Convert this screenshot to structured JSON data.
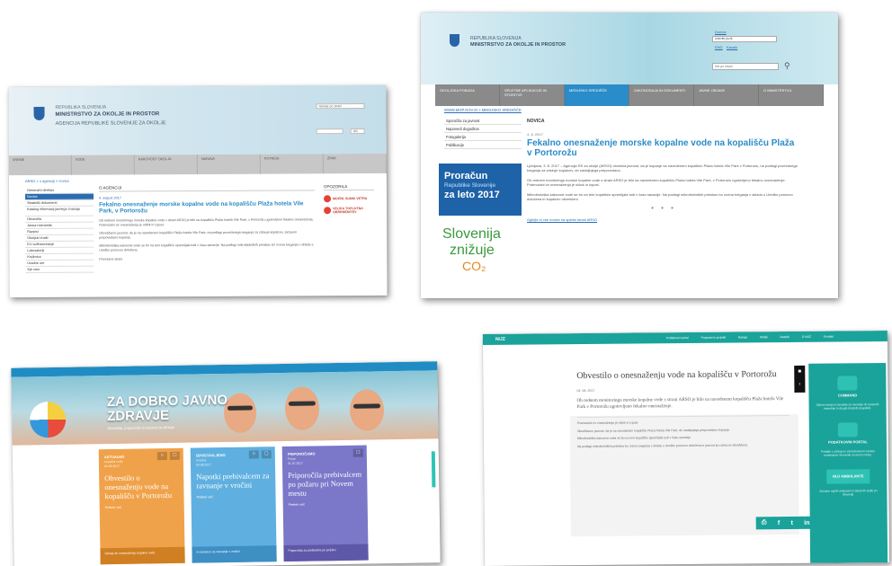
{
  "shot1": {
    "header": {
      "line1": "REPUBLIKA SLOVENIJA",
      "line2": "MINISTRSTVO ZA OKOLJE IN PROSTOR",
      "line3": "AGENCIJA REPUBLIKE SLOVENIJE ZA OKOLJE",
      "search_placeholder": "Iskanje po strani",
      "button_label": "Išči"
    },
    "nav": [
      "VREME",
      "VODE",
      "KAKOVOST OKOLJA",
      "NARAVA",
      "POTRESI",
      "ZRAK"
    ],
    "breadcrumb": "ARSO > o agenciji > novice",
    "left_nav": [
      "Generalni direktor",
      "Novice",
      "Strateški dokumenti",
      "Katalog informacij javnega značaja",
      "Obvestila",
      "Javna naznanila",
      "Razpisi",
      "Okoljski znaki",
      "EU sofinanciranje",
      "Laboratoriji",
      "Knjižnica",
      "Uradne ure",
      "Kje smo"
    ],
    "section": "O AGENCIJI",
    "date": "4. avgust 2017",
    "headline": "Fekalno onesnaženje morske kopalne vode na kopališču Plaža hotela Vile Park, v Portorožu",
    "paragraphs": [
      "Ob rednem monitoringu morske kopalne vode v strani ARSO je bilo na kopališču Plaža hotela Vile Park, v Portorožu ugotovljeno fekalno onesnaženje. Potencialni vir onesnaženja je odtok in izpust.",
      "Obveščamo javnost, da je na navedenem kopališču Plaža hotela Vile Park, na podlagi povečanega tveganja za zdravje kopalcev, začasno prepovedano kopanje.",
      "Mikrobiološka kakovost vode se bo na tem kopališču spremljala tudi v času sanacije. Na podlagi mikrobioloških preiskav bo ocena tveganja v skladu s Uredbo ponovno določena."
    ],
    "footer_label": "Povezane strani",
    "right_title": "OPOZORILA",
    "warnings": [
      "MOČNI, SUNKI VETRA",
      "VELIKA TOPLOTNA OBREMENITEV"
    ]
  },
  "shot2": {
    "header": {
      "line1": "REPUBLIKA SLOVENIJA",
      "line2": "MINISTRSTVO ZA OKOLJE IN PROSTOR",
      "link_top": "Domov",
      "select_value": "Izberite jezik",
      "link_en": "ENG",
      "link_sitemap": "Kazalo",
      "search_placeholder": "Išči po strani",
      "search_icon": "magnifier-icon"
    },
    "nav": [
      "OKOLJSKA POBUDA",
      "SPLETNE APLIKACIJE IN STORITVE",
      "MEDIJSKO SREDIŠČE",
      "ZAKONODAJA IN DOKUMENTI",
      "JAVNE OBJAVE",
      "O MINISTRSTVU"
    ],
    "breadcrumb": "WWW.MOP.GOV.SI > MEDIJSKO SREDIŠČE",
    "left_nav": [
      "Sporočila za javnost",
      "Napovedi dogodkov",
      "Fotogalerija",
      "Publikacije"
    ],
    "banner1": {
      "line1": "Proračun",
      "line2": "Republike Slovenije",
      "line3": "za leto 2017"
    },
    "banner2": {
      "line1": "Slovenija",
      "line2": "znižuje",
      "line3": "CO₂"
    },
    "section": "NOVICA",
    "date": "4. 8. 2017",
    "headline": "Fekalno onesnaženje morske kopalne vode na kopališču Plaža v Portorožu",
    "paragraphs": [
      "Ljubljana, 3. 8. 2017 – Agencija RS za okolje (ARSO) obvešča javnost, da je kopanje na navedenem kopališču Plaža hotela Vile Park v Portorožu, na podlagi povečanega tveganja za zdravje kopalcev, do nadaljnjega prepovedano.",
      "Ob rednem monitoringu morske kopalne vode s strani ARSO je bilo na navedenem kopališču Plaža hotela Vile Park, v Portorožu ugotovljeno fekalno onesnaženje. Potencialni vir onesnaženja je odtok in izpust.",
      "Mikrobiološka kakovost vode se bo na tem kopališču spremljala tudi v času sanacije. Na podlagi mikrobioloških preiskav bo ocena tveganja v skladu s Uredbo ponovno določena in kopalcev obveščeni."
    ],
    "dots": "• • •",
    "more_link": "Oglejte si vse novice na spletni strani ARSO"
  },
  "shot3": {
    "hero_title_1": "ZA DOBRO JAVNO",
    "hero_title_2": "ZDRAVJE",
    "hero_sub": "Obvestila, priporočila in nasveti za zdravje",
    "cards": [
      {
        "category": "AKTUALNO",
        "meta": "Kopalne vode",
        "date": "04.08.2017",
        "title": "Obvestilo o onesnaženju vode na kopališču v Portorožu",
        "more": "Preberi več",
        "footer": "Ukrepi ob onesnaženju kopalne vode"
      },
      {
        "category": "IZPOSTAVLJENO",
        "meta": "Vročina",
        "date": "03.08.2017",
        "title": "Napotki prebivalcem za ravnanje v vročini",
        "more": "Preberi več",
        "footer": "6 nasvetov za ravnanje v vročini"
      },
      {
        "category": "PRIPOROČAMO",
        "meta": "Požar",
        "date": "31.07.2017",
        "title": "Priporočila prebivalcem po požaru pri Novem mestu",
        "more": "Preberi več",
        "footer": "Priporočila za prebivalce po požaru"
      }
    ],
    "card_icons": [
      "rss-icon",
      "folder-icon"
    ]
  },
  "shot4": {
    "logo": "NIJZ",
    "top_nav": [
      "Podatkovni portal",
      "Programi in projekti",
      "Naloge",
      "Mediji",
      "Razpisi",
      "O NIJZ",
      "Kontakt"
    ],
    "headline": "Obvestilo o onesnaženju vode na kopališču v Portorožu",
    "date": "04. 08. 2017",
    "lead": "Ob rednem monitoringu morske kopalne vode s strani ARSO je bilo na navedenem kopališču Plaža hotela Vile Park v Portorožu ugotovljeno fekalno onesnaženje.",
    "paragraphs": [
      "Potencialni vir onesnaženja je odtok in izpust.",
      "Obveščamo javnost, da je na navedenem kopališču Plaža hotela Vile Park, do nadaljnjega prepovedano kopanje.",
      "Mikrobiološka kakovost vode se bo na tem kopališču spremljala tudi v času sanacije.",
      "Na podlagi mikrobioloških preiskav bo ocena tveganja v skladu s Uredbo ponovno določena in javnost bo ustrezno obveščena."
    ],
    "social_icons": [
      "print-icon",
      "facebook-icon",
      "twitter-icon",
      "linkedin-icon"
    ],
    "sidebar": [
      {
        "label": "COMMAND",
        "text": "Zbirna mesta in navodila za ravnanje ob naravnih nesrečah in drugih izrednih dogodkih."
      },
      {
        "label": "PODATKOVNI PORTAL",
        "text": "Podatki o zdravju in zdravstvenem varstvu prebivalcev Slovenije na enem mestu."
      },
      {
        "label": "NUJ AMBULANTE",
        "text": "Seznam nujnih ambulant in dežurnih služb po Sloveniji."
      }
    ]
  }
}
